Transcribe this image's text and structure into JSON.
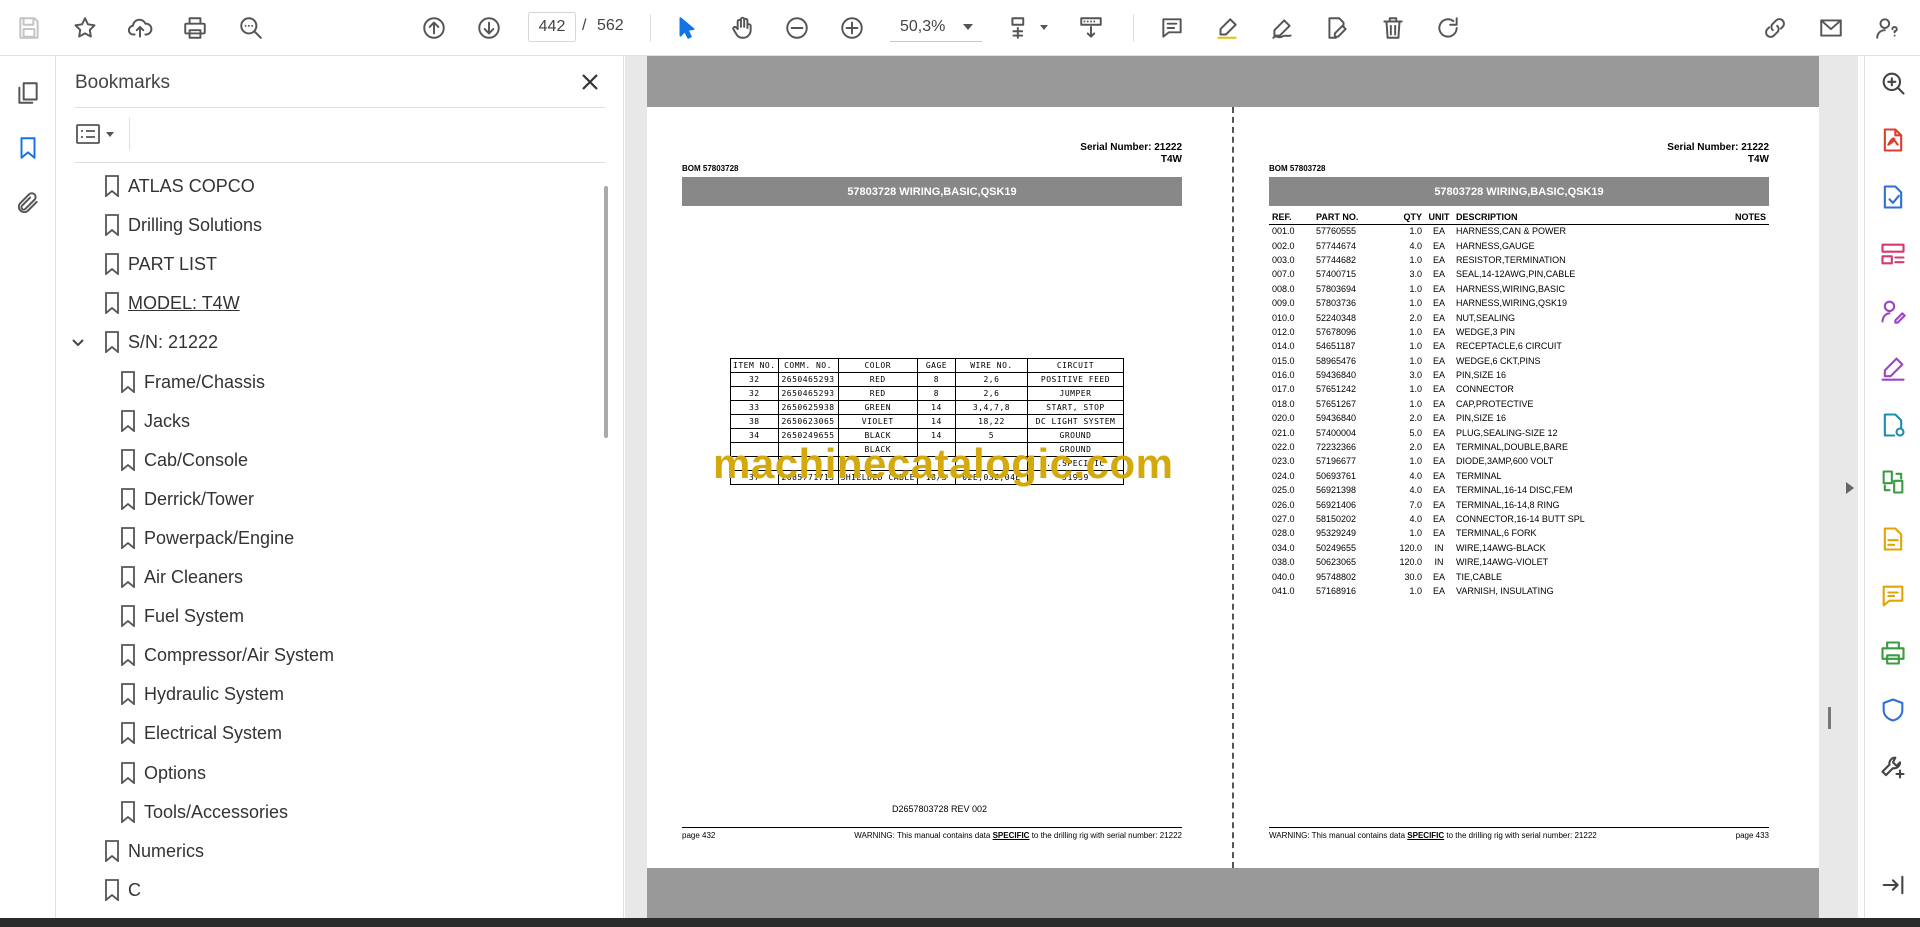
{
  "toolbar": {
    "current_page": "442",
    "page_separator": "/",
    "total_pages": "562",
    "zoom": "50,3%"
  },
  "bookmarks_panel": {
    "title": "Bookmarks",
    "items": [
      {
        "label": "ATLAS COPCO",
        "level": 0
      },
      {
        "label": "Drilling Solutions",
        "level": 0
      },
      {
        "label": "PART LIST",
        "level": 0
      },
      {
        "label": "MODEL: T4W",
        "level": 0,
        "underlined": true
      },
      {
        "label": "S/N: 21222",
        "level": 0,
        "expanded": true
      },
      {
        "label": "Frame/Chassis",
        "level": 1
      },
      {
        "label": "Jacks",
        "level": 1
      },
      {
        "label": "Cab/Console",
        "level": 1
      },
      {
        "label": "Derrick/Tower",
        "level": 1
      },
      {
        "label": "Powerpack/Engine",
        "level": 1
      },
      {
        "label": "Air Cleaners",
        "level": 1
      },
      {
        "label": "Fuel System",
        "level": 1
      },
      {
        "label": "Compressor/Air System",
        "level": 1
      },
      {
        "label": "Hydraulic System",
        "level": 1
      },
      {
        "label": "Electrical System",
        "level": 1
      },
      {
        "label": "Options",
        "level": 1
      },
      {
        "label": "Tools/Accessories",
        "level": 1
      },
      {
        "label": "Numerics",
        "level": 0
      },
      {
        "label": "C",
        "level": 0
      }
    ]
  },
  "document": {
    "watermark": "machinecatalogic.com",
    "left_page": {
      "serial": "Serial Number: 21222",
      "model": "T4W",
      "bom": "BOM 57803728",
      "header": "57803728 WIRING,BASIC,QSK19",
      "wire_table": {
        "headers": [
          "ITEM NO.",
          "COMM. NO.",
          "COLOR",
          "GAGE",
          "WIRE NO.",
          "CIRCUIT"
        ],
        "rows": [
          [
            "32",
            "2650465293",
            "RED",
            "8",
            "2,6",
            "POSITIVE FEED"
          ],
          [
            "32",
            "2650465293",
            "RED",
            "8",
            "2,6",
            "JUMPER"
          ],
          [
            "33",
            "2650625938",
            "GREEN",
            "14",
            "3,4,7,8",
            "START, STOP"
          ],
          [
            "38",
            "2650623065",
            "VIOLET",
            "14",
            "18,22",
            "DC LIGHT SYSTEM"
          ],
          [
            "34",
            "2650249655",
            "BLACK",
            "14",
            "5",
            "GROUND"
          ],
          [
            "",
            "",
            "BLACK",
            "",
            "",
            "GROUND"
          ],
          [
            "",
            "",
            "",
            "",
            "",
            "...SPECIFIC"
          ],
          [
            "37",
            "2685771715",
            "SHIELDED CABLE",
            "18/3",
            "02E,03E,04E",
            "J1939"
          ]
        ]
      },
      "doc_code": "D2657803728 REV 002",
      "page_label": "page 432",
      "warning_prefix": "WARNING:  This manual contains data ",
      "warning_emph": "SPECIFIC",
      "warning_suffix": " to the drilling rig with serial number: 21222"
    },
    "right_page": {
      "serial": "Serial Number: 21222",
      "model": "T4W",
      "bom": "BOM 57803728",
      "header": "57803728 WIRING,BASIC,QSK19",
      "columns": [
        "REF.",
        "PART NO.",
        "QTY",
        "UNIT",
        "DESCRIPTION",
        "NOTES"
      ],
      "rows": [
        [
          "001.0",
          "57760555",
          "1.0",
          "EA",
          "HARNESS,CAN & POWER"
        ],
        [
          "002.0",
          "57744674",
          "4.0",
          "EA",
          "HARNESS,GAUGE"
        ],
        [
          "003.0",
          "57744682",
          "1.0",
          "EA",
          "RESISTOR,TERMINATION"
        ],
        [
          "007.0",
          "57400715",
          "3.0",
          "EA",
          "SEAL,14-12AWG,PIN,CABLE"
        ],
        [
          "008.0",
          "57803694",
          "1.0",
          "EA",
          "HARNESS,WIRING,BASIC"
        ],
        [
          "009.0",
          "57803736",
          "1.0",
          "EA",
          "HARNESS,WIRING,QSK19"
        ],
        [
          "010.0",
          "52240348",
          "2.0",
          "EA",
          "NUT,SEALING"
        ],
        [
          "012.0",
          "57678096",
          "1.0",
          "EA",
          "WEDGE,3 PIN"
        ],
        [
          "014.0",
          "54651187",
          "1.0",
          "EA",
          "RECEPTACLE,6 CIRCUIT"
        ],
        [
          "015.0",
          "58965476",
          "1.0",
          "EA",
          "WEDGE,6 CKT,PINS"
        ],
        [
          "016.0",
          "59436840",
          "3.0",
          "EA",
          "PIN,SIZE 16"
        ],
        [
          "017.0",
          "57651242",
          "1.0",
          "EA",
          "CONNECTOR"
        ],
        [
          "018.0",
          "57651267",
          "1.0",
          "EA",
          "CAP,PROTECTIVE"
        ],
        [
          "020.0",
          "59436840",
          "2.0",
          "EA",
          "PIN,SIZE 16"
        ],
        [
          "021.0",
          "57400004",
          "5.0",
          "EA",
          "PLUG,SEALING-SIZE 12"
        ],
        [
          "022.0",
          "72232366",
          "2.0",
          "EA",
          "TERMINAL,DOUBLE,BARE"
        ],
        [
          "023.0",
          "57196677",
          "1.0",
          "EA",
          "DIODE,3AMP,600 VOLT"
        ],
        [
          "024.0",
          "50693761",
          "4.0",
          "EA",
          "TERMINAL"
        ],
        [
          "025.0",
          "56921398",
          "4.0",
          "EA",
          "TERMINAL,16-14 DISC,FEM"
        ],
        [
          "026.0",
          "56921406",
          "7.0",
          "EA",
          "TERMINAL,16-14,8 RING"
        ],
        [
          "027.0",
          "58150202",
          "4.0",
          "EA",
          "CONNECTOR,16-14 BUTT SPL"
        ],
        [
          "028.0",
          "95329249",
          "1.0",
          "EA",
          "TERMINAL,6 FORK"
        ],
        [
          "034.0",
          "50249655",
          "120.0",
          "IN",
          "WIRE,14AWG-BLACK"
        ],
        [
          "038.0",
          "50623065",
          "120.0",
          "IN",
          "WIRE,14AWG-VIOLET"
        ],
        [
          "040.0",
          "95748802",
          "30.0",
          "EA",
          "TIE,CABLE"
        ],
        [
          "041.0",
          "57168916",
          "1.0",
          "EA",
          "VARNISH, INSULATING"
        ]
      ],
      "page_label": "page 433",
      "warning_prefix": "WARNING:  This manual contains data ",
      "warning_emph": "SPECIFIC",
      "warning_suffix": " to the drilling rig with serial number: 21222"
    }
  }
}
